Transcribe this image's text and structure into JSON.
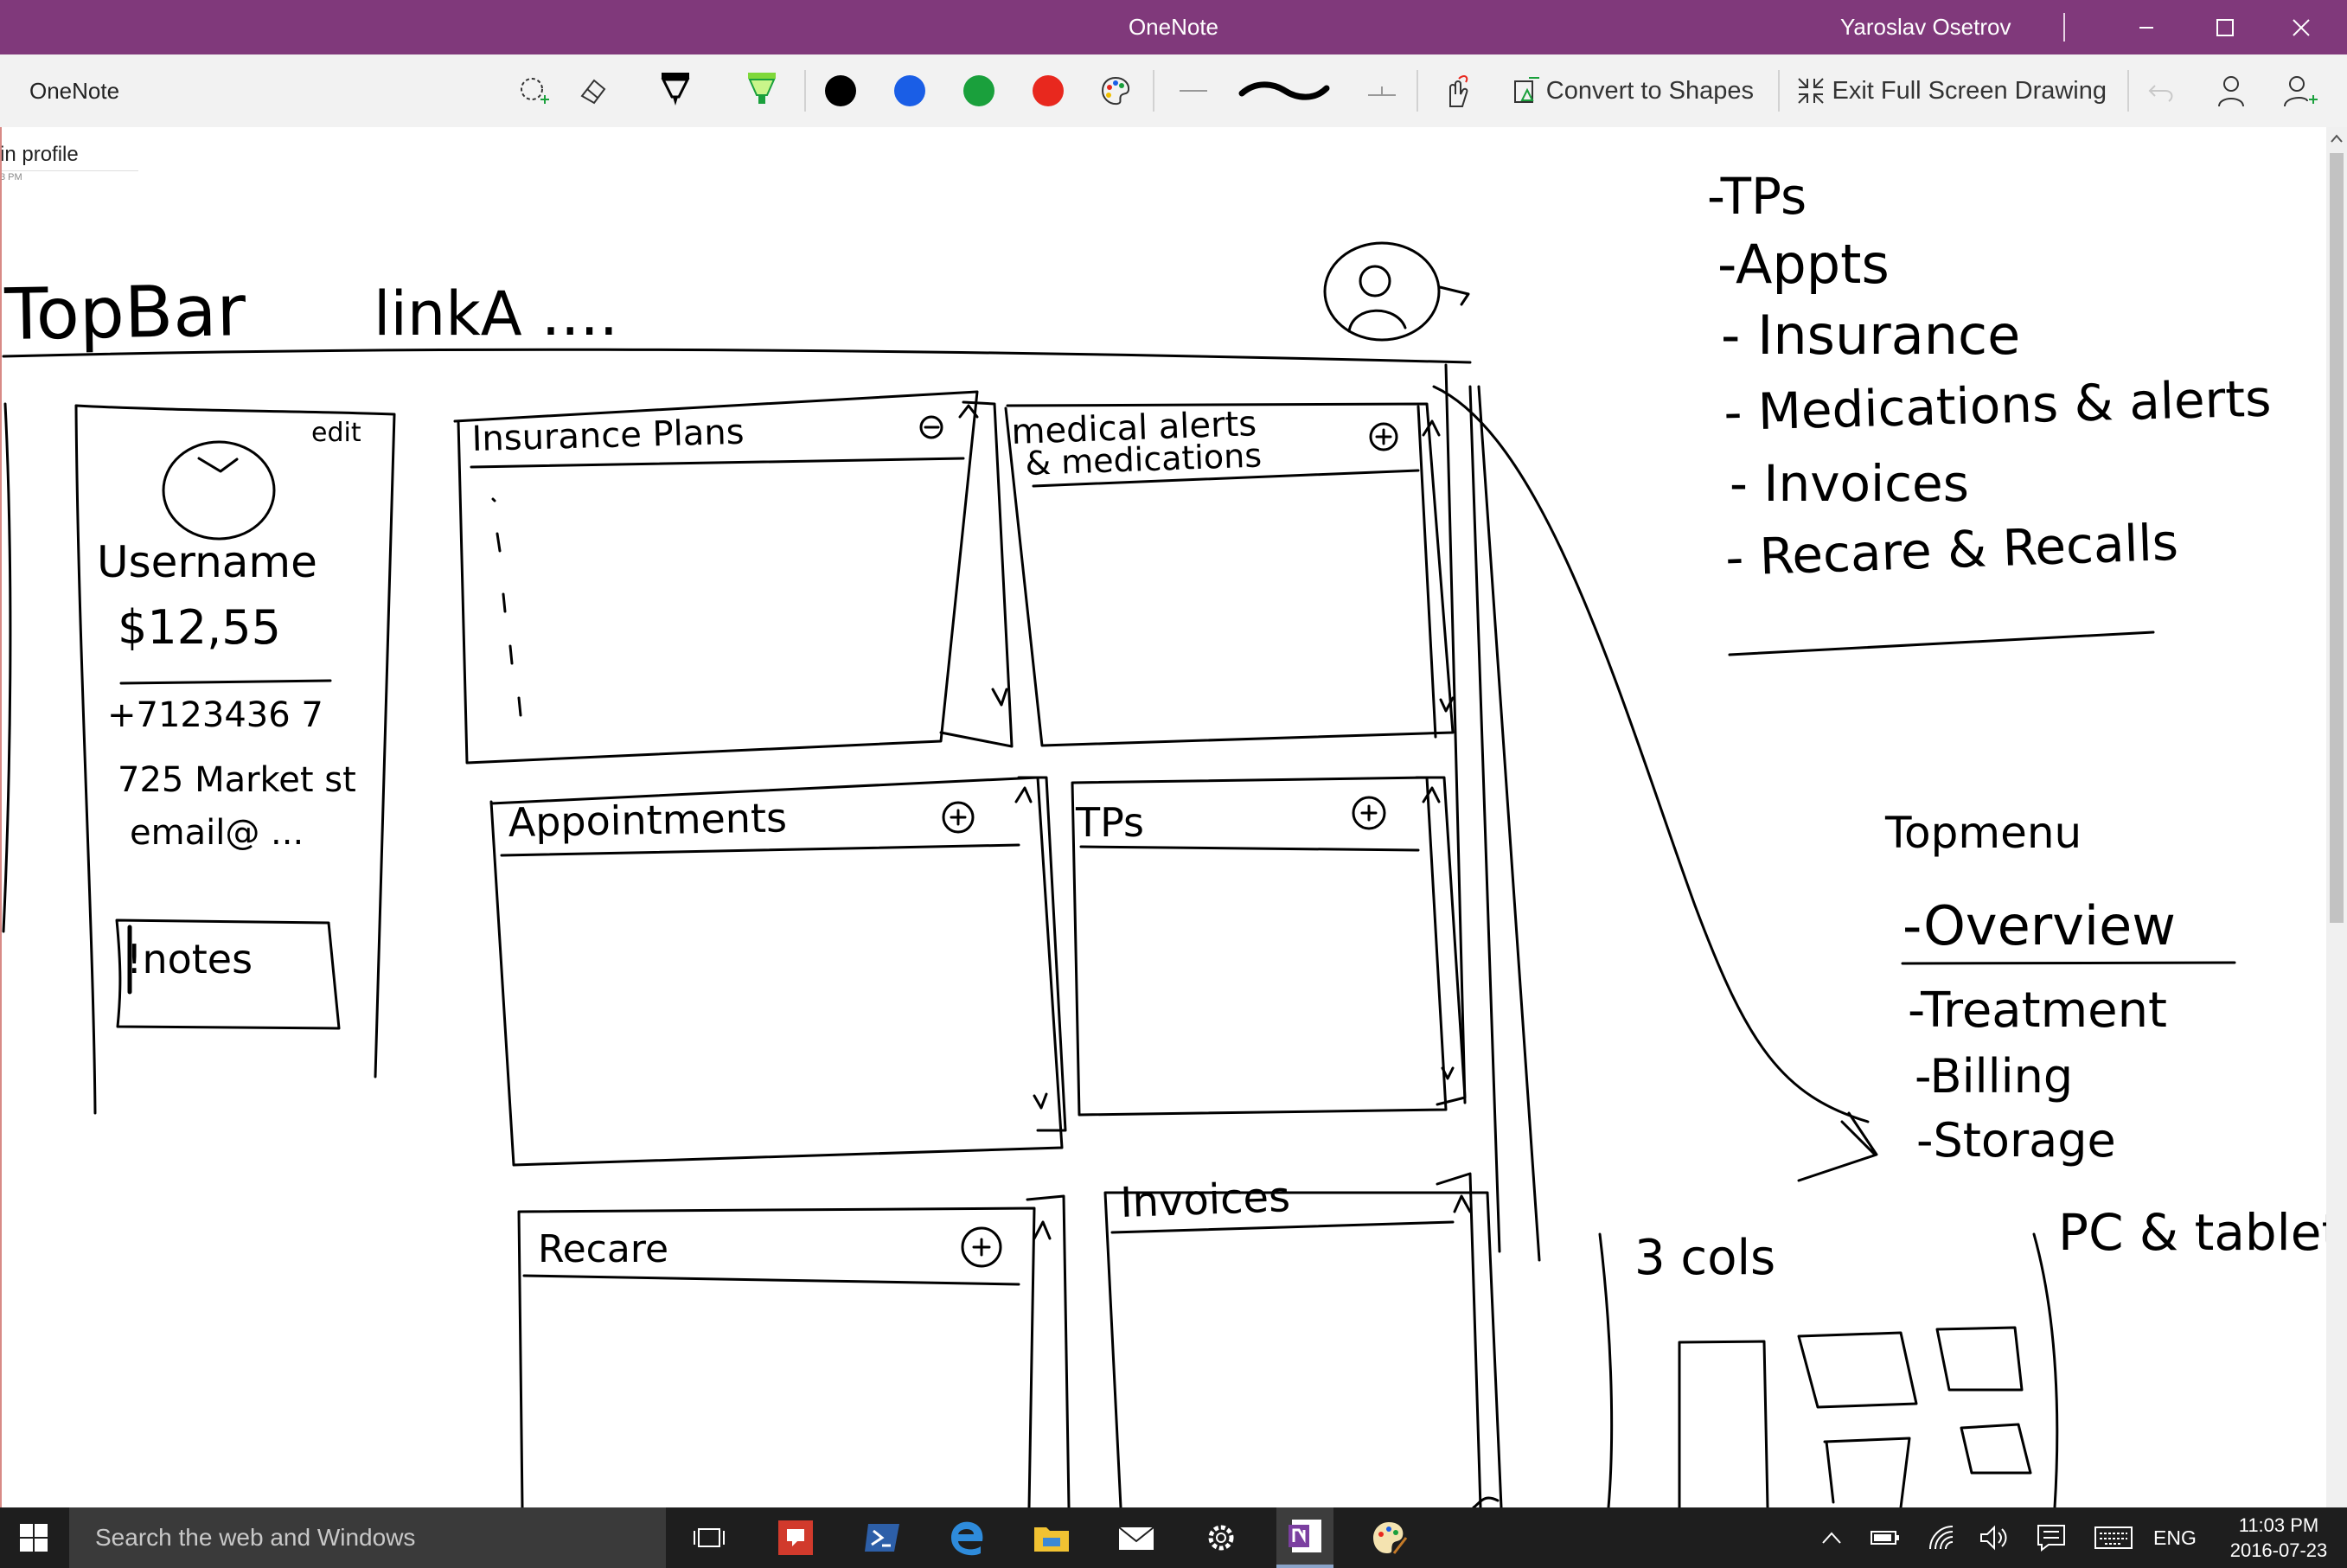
{
  "window": {
    "title": "OneNote",
    "user_name": "Yaroslav Osetrov"
  },
  "toolbar": {
    "app_name": "OneNote",
    "tools": [
      {
        "icon": "lasso-select-icon"
      },
      {
        "icon": "eraser-icon"
      },
      {
        "icon": "pen-icon"
      },
      {
        "icon": "highlighter-icon"
      }
    ],
    "colors": [
      "#000000",
      "#1a5ee6",
      "#1aa03c",
      "#e8281e"
    ],
    "convert_label": "Convert to Shapes",
    "exit_label": "Exit Full Screen Drawing"
  },
  "page": {
    "title": "in profile",
    "time": "3 PM"
  },
  "sketch": {
    "topbar_label": "TopBar",
    "topbar_link": "linkA ....",
    "profile": {
      "edit": "edit",
      "username": "Username",
      "balance": "$12,55",
      "phone": "+7123436 7",
      "address": "725 Market st",
      "email": "email@ ...",
      "notes": "!notes"
    },
    "panels": {
      "insurance": "Insurance Plans",
      "alerts_line1": "medical alerts",
      "alerts_line2": "& medications",
      "appointments": "Appointments",
      "tps": "TPs",
      "recare": "Recare",
      "invoices": "Invoices"
    },
    "sections_list": [
      "-TPs",
      "-Appts",
      "- Insurance",
      "- Medications & alerts",
      "- Invoices",
      "- Recare & Recalls"
    ],
    "topmenu": {
      "heading": "Topmenu",
      "items": [
        "-Overview",
        "-Treatment",
        "-Billing",
        "-Storage"
      ]
    },
    "cols_note": "3 cols",
    "devices_note": "PC & tablets"
  },
  "taskbar": {
    "search_placeholder": "Search the web and Windows",
    "apps": [
      {
        "icon": "task-view-icon"
      },
      {
        "icon": "feedback-app-icon"
      },
      {
        "icon": "powershell-icon"
      },
      {
        "icon": "edge-browser-icon"
      },
      {
        "icon": "file-explorer-icon"
      },
      {
        "icon": "mail-icon"
      },
      {
        "icon": "settings-icon"
      },
      {
        "icon": "onenote-icon"
      },
      {
        "icon": "paint-icon"
      }
    ],
    "lang": "ENG",
    "time": "11:03 PM",
    "date": "2016-07-23"
  }
}
